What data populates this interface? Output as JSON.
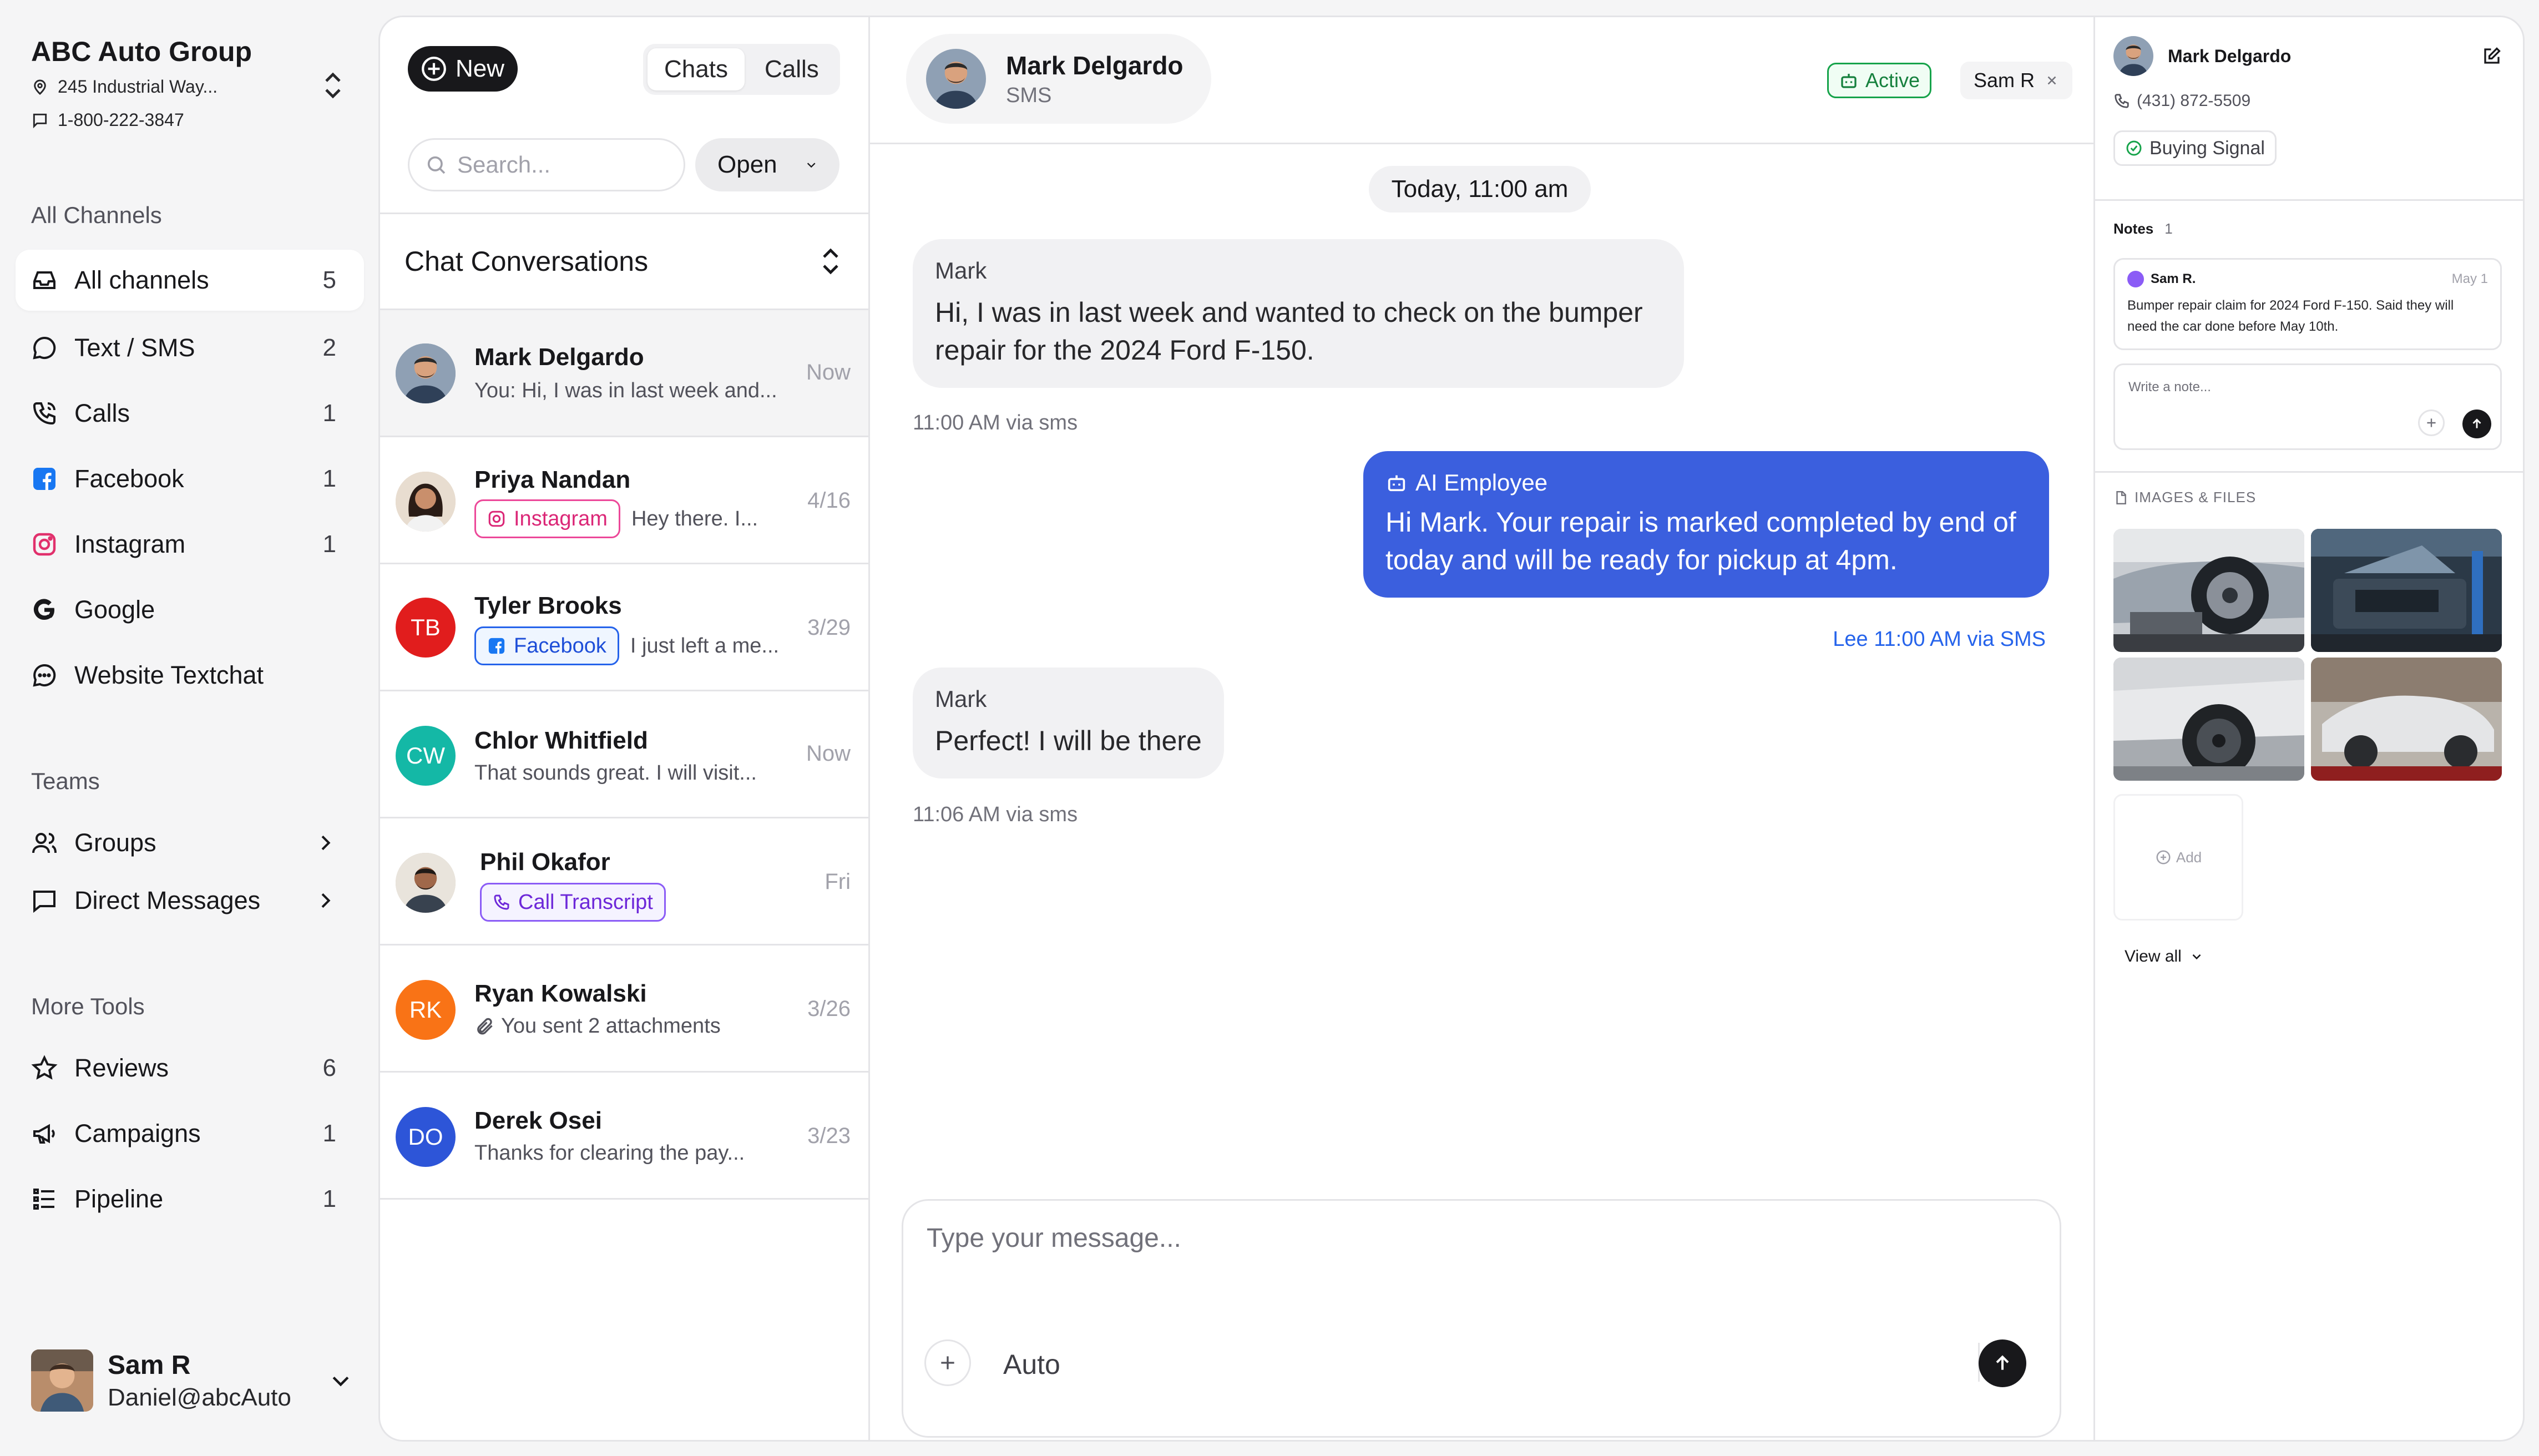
{
  "org": {
    "name": "ABC Auto Group",
    "address": "245 Industrial Way...",
    "phone": "1-800-222-3847"
  },
  "sidebar": {
    "channels_heading": "All Channels",
    "channels": [
      {
        "label": "All  channels",
        "count": "5",
        "icon": "inbox-icon"
      },
      {
        "label": "Text / SMS",
        "count": "2",
        "icon": "message-icon"
      },
      {
        "label": "Calls",
        "count": "1",
        "icon": "phone-icon"
      },
      {
        "label": "Facebook",
        "count": "1",
        "icon": "facebook-icon"
      },
      {
        "label": "Instagram",
        "count": "1",
        "icon": "instagram-icon"
      },
      {
        "label": "Google",
        "count": "",
        "icon": "google-icon"
      },
      {
        "label": "Website Textchat",
        "count": "",
        "icon": "chat-bubble-icon"
      }
    ],
    "teams_heading": "Teams",
    "teams": [
      {
        "label": "Groups",
        "icon": "users-icon"
      },
      {
        "label": "Direct Messages",
        "icon": "message-square-icon"
      }
    ],
    "tools_heading": "More Tools",
    "tools": [
      {
        "label": "Reviews",
        "count": "6",
        "icon": "star-icon"
      },
      {
        "label": "Campaigns",
        "count": "1",
        "icon": "megaphone-icon"
      },
      {
        "label": "Pipeline",
        "count": "1",
        "icon": "list-icon"
      }
    ],
    "user": {
      "name": "Sam R",
      "email": "Daniel@abcAuto"
    }
  },
  "list": {
    "new_label": "New",
    "tabs": [
      "Chats",
      "Calls"
    ],
    "search_placeholder": "Search...",
    "status_filter": "Open",
    "heading": "Chat Conversations",
    "conversations": [
      {
        "name": "Mark Delgardo",
        "preview": "You: Hi, I was in last week and...",
        "time": "Now",
        "tag": "",
        "initials": ""
      },
      {
        "name": "Priya Nandan",
        "preview": "Hey there. I...",
        "time": "4/16",
        "tag": "Instagram",
        "initials": ""
      },
      {
        "name": "Tyler Brooks",
        "preview": "I just left a me...",
        "time": "3/29",
        "tag": "Facebook",
        "initials": "TB"
      },
      {
        "name": "Chlor Whitfield",
        "preview": "That sounds great. I will visit...",
        "time": "Now",
        "tag": "",
        "initials": "CW"
      },
      {
        "name": "Phil Okafor",
        "preview": "",
        "time": "Fri",
        "tag": "Call Transcript",
        "initials": ""
      },
      {
        "name": "Ryan Kowalski",
        "preview": "You sent 2 attachments",
        "time": "3/26",
        "tag": "",
        "initials": "RK"
      },
      {
        "name": "Derek Osei",
        "preview": "Thanks for clearing the pay...",
        "time": "3/23",
        "tag": "",
        "initials": "DO"
      }
    ]
  },
  "chat": {
    "contact_name": "Mark Delgardo",
    "contact_channel": "SMS",
    "status": "Active",
    "assignee": "Sam R",
    "date_divider": "Today, 11:00 am",
    "messages": [
      {
        "sender": "Mark",
        "text_line1": "Hi, I was in last week and wanted to check on the bumper",
        "text_line2": "repair for the 2024 Ford F-150.",
        "meta": "11:00 AM via sms"
      },
      {
        "sender": "AI Employee",
        "text_line1": "Hi Mark. Your repair is marked completed by end of",
        "text_line2": "today and will be ready for pickup at 4pm.",
        "meta": "Lee 11:00 AM via SMS"
      },
      {
        "sender": "Mark",
        "text_line1": "Perfect! I will be there",
        "text_line2": "",
        "meta": "11:06 AM via sms"
      }
    ],
    "composer_placeholder": "Type your message...",
    "mode": "Auto"
  },
  "profile": {
    "name": "Mark Delgardo",
    "phone": "(431) 872-5509",
    "signal": "Buying Signal",
    "notes_heading": "Notes",
    "notes_count": "1",
    "note": {
      "author": "Sam R.",
      "date": "May 1",
      "text_line1": "Bumper repair claim for 2024 Ford F-150. Said they will",
      "text_line2": "need the car done before May 10th."
    },
    "note_placeholder": "Write a note...",
    "files_heading": "IMAGES & FILES",
    "add_label": "Add",
    "view_all": "View all"
  },
  "colors": {
    "accent": "#3b5fde",
    "active_green": "#16a34a",
    "facebook": "#1877f2",
    "instagram": "#e1306c"
  }
}
